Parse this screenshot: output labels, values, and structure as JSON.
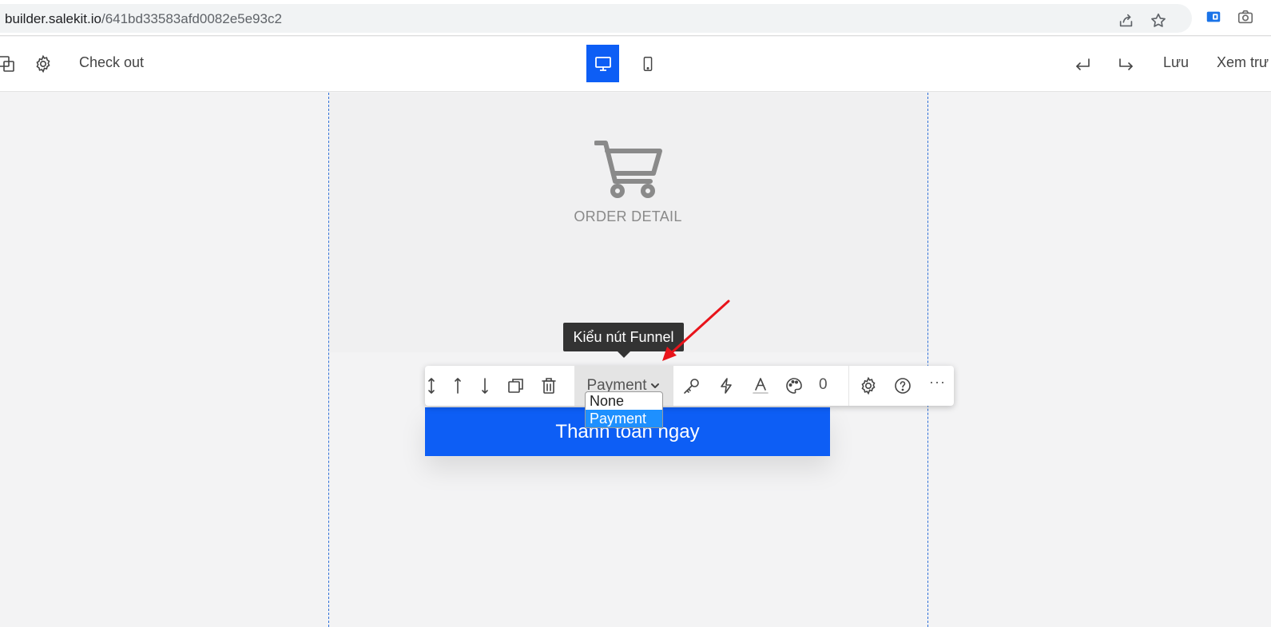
{
  "browser": {
    "url_host": "builder.salekit.io",
    "url_path": "/641bd33583afd0082e5e93c2"
  },
  "topbar": {
    "page_name": "Check out",
    "save_label": "Lưu",
    "preview_label": "Xem trư"
  },
  "canvas": {
    "order_title": "ORDER DETAIL",
    "cta_label": "Thanh toán ngay"
  },
  "element_toolbar": {
    "type_value": "Payment",
    "count": "0",
    "more_label": "···"
  },
  "tooltip": {
    "text": "Kiểu nút Funnel"
  },
  "dropdown": {
    "options": [
      "None",
      "Payment"
    ],
    "selected": "Payment"
  },
  "colors": {
    "accent": "#0d5ef5",
    "select_highlight": "#1e90ff",
    "annotation": "#e8141b"
  }
}
